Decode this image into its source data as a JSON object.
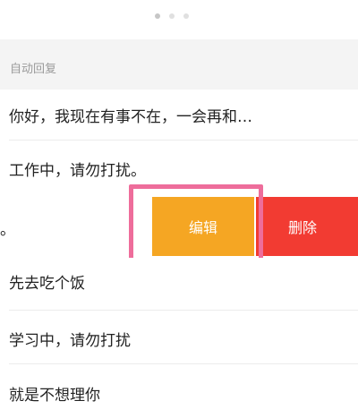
{
  "auto_reply": {
    "section_title": "自动回复",
    "items": [
      {
        "text": "你好，我现在有事不在，一会再和…"
      },
      {
        "text": "工作中，请勿打扰。"
      },
      {
        "text": "。"
      },
      {
        "text": "先去吃个饭"
      },
      {
        "text": "学习中，请勿打扰"
      },
      {
        "text": "就是不想理你"
      }
    ],
    "actions": {
      "edit_label": "编辑",
      "delete_label": "删除"
    }
  },
  "pager": {
    "count": 3,
    "active_index": 0
  },
  "colors": {
    "edit": "#f5a623",
    "delete": "#f23b32",
    "highlight": "#ee6d9b",
    "section_bg": "#f4f4f4"
  }
}
